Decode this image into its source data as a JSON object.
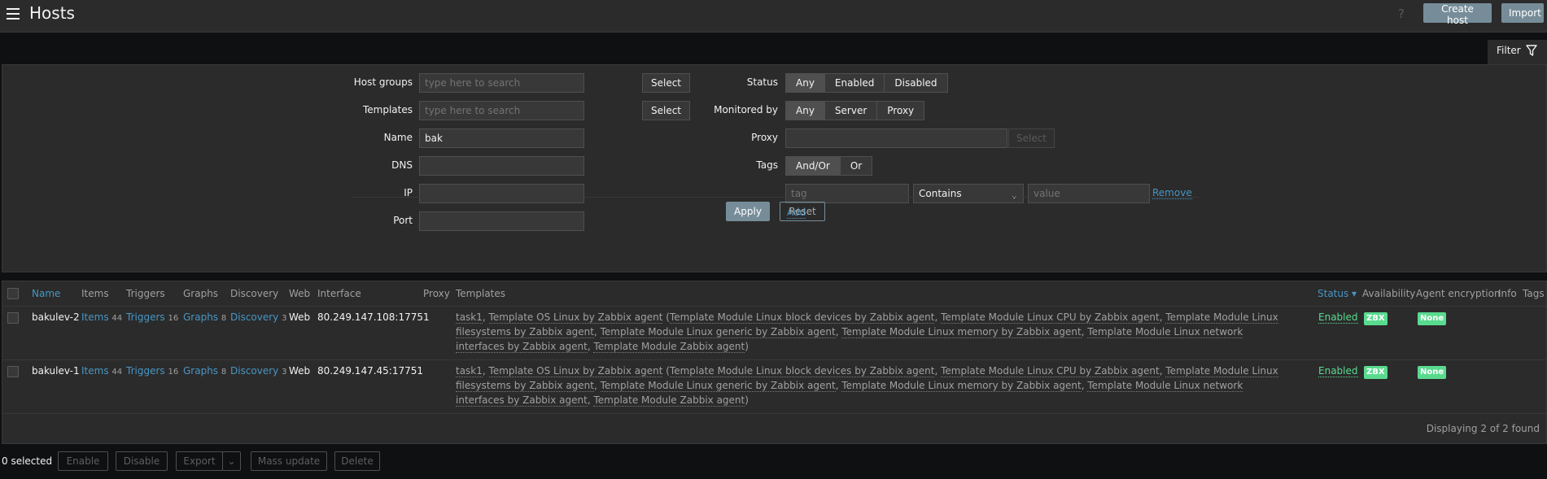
{
  "header": {
    "title": "Hosts",
    "help": "?",
    "create_host": "Create host",
    "import": "Import"
  },
  "filter": {
    "tab_label": "Filter",
    "host_groups": {
      "label": "Host groups",
      "placeholder": "type here to search",
      "button": "Select"
    },
    "templates": {
      "label": "Templates",
      "placeholder": "type here to search",
      "button": "Select"
    },
    "name": {
      "label": "Name",
      "value": "bak"
    },
    "dns": {
      "label": "DNS",
      "value": ""
    },
    "ip": {
      "label": "IP",
      "value": ""
    },
    "port": {
      "label": "Port",
      "value": ""
    },
    "status": {
      "label": "Status",
      "options": [
        "Any",
        "Enabled",
        "Disabled"
      ],
      "selected": "Any"
    },
    "monitored_by": {
      "label": "Monitored by",
      "options": [
        "Any",
        "Server",
        "Proxy"
      ],
      "selected": "Any"
    },
    "proxy": {
      "label": "Proxy",
      "value": "",
      "button": "Select"
    },
    "tags": {
      "label": "Tags",
      "options": [
        "And/Or",
        "Or"
      ],
      "selected": "And/Or",
      "tag_placeholder": "tag",
      "operator": "Contains",
      "value_placeholder": "value",
      "remove": "Remove",
      "add": "Add"
    },
    "apply": "Apply",
    "reset": "Reset"
  },
  "table": {
    "columns": [
      "Name",
      "Items",
      "Triggers",
      "Graphs",
      "Discovery",
      "Web",
      "Interface",
      "Proxy",
      "Templates",
      "Status ▾",
      "Availability",
      "Agent encryption",
      "Info",
      "Tags"
    ],
    "rows": [
      {
        "name": "bakulev-2",
        "items": "Items",
        "items_count": "44",
        "triggers": "Triggers",
        "triggers_count": "16",
        "graphs": "Graphs",
        "graphs_count": "8",
        "discovery": "Discovery",
        "discovery_count": "3",
        "web": "Web",
        "interface": "80.249.147.108:17751",
        "proxy": "",
        "templates": {
          "first": "task1",
          "main": "Template OS Linux by Zabbix agent",
          "children": [
            "Template Module Linux block devices by Zabbix agent",
            "Template Module Linux CPU by Zabbix agent",
            "Template Module Linux filesystems by Zabbix agent",
            "Template Module Linux generic by Zabbix agent",
            "Template Module Linux memory by Zabbix agent",
            "Template Module Linux network interfaces by Zabbix agent",
            "Template Module Zabbix agent"
          ]
        },
        "status": "Enabled",
        "availability": "ZBX",
        "encryption": "None"
      },
      {
        "name": "bakulev-1",
        "items": "Items",
        "items_count": "44",
        "triggers": "Triggers",
        "triggers_count": "16",
        "graphs": "Graphs",
        "graphs_count": "8",
        "discovery": "Discovery",
        "discovery_count": "3",
        "web": "Web",
        "interface": "80.249.147.45:17751",
        "proxy": "",
        "templates": {
          "first": "task1",
          "main": "Template OS Linux by Zabbix agent",
          "children": [
            "Template Module Linux block devices by Zabbix agent",
            "Template Module Linux CPU by Zabbix agent",
            "Template Module Linux filesystems by Zabbix agent",
            "Template Module Linux generic by Zabbix agent",
            "Template Module Linux memory by Zabbix agent",
            "Template Module Linux network interfaces by Zabbix agent",
            "Template Module Zabbix agent"
          ]
        },
        "status": "Enabled",
        "availability": "ZBX",
        "encryption": "None"
      }
    ],
    "displaying": "Displaying 2 of 2 found"
  },
  "footer": {
    "selected": "0 selected",
    "enable": "Enable",
    "disable": "Disable",
    "export": "Export",
    "mass_update": "Mass update",
    "delete": "Delete"
  },
  "colors": {
    "accent": "#768d99",
    "link": "#4796c4",
    "status_green": "#59db8f"
  }
}
